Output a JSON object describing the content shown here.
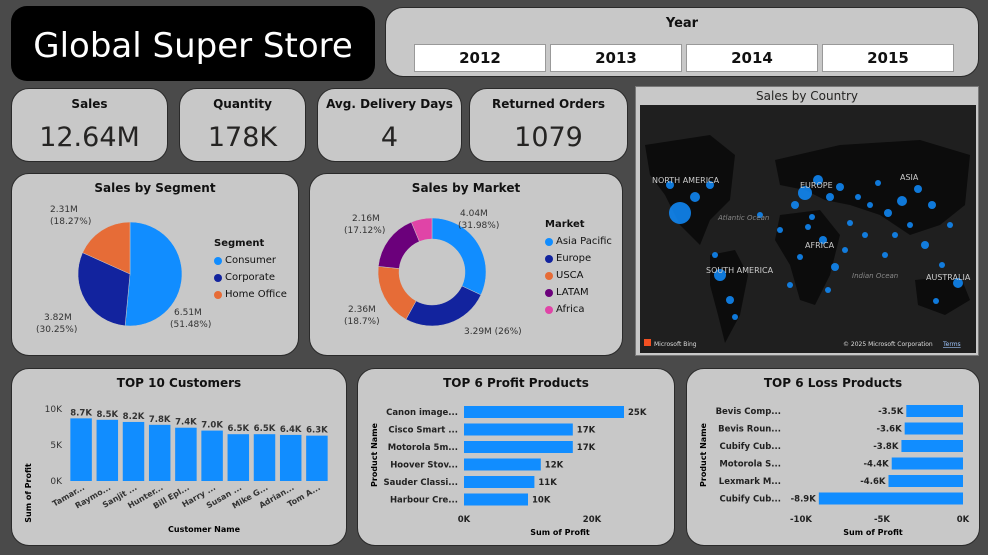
{
  "title": "Global Super Store",
  "year_filter": {
    "label": "Year",
    "options": [
      "2012",
      "2013",
      "2014",
      "2015"
    ]
  },
  "kpis": [
    {
      "label": "Sales",
      "value": "12.64M"
    },
    {
      "label": "Quantity",
      "value": "178K"
    },
    {
      "label": "Avg. Delivery Days",
      "value": "4"
    },
    {
      "label": "Returned Orders",
      "value": "1079"
    }
  ],
  "segment_chart": {
    "title": "Sales by Segment",
    "legend_title": "Segment",
    "slice_labels": [
      {
        "line1": "6.51M",
        "line2": "(51.48%)"
      },
      {
        "line1": "3.82M",
        "line2": "(30.25%)"
      },
      {
        "line1": "2.31M",
        "line2": "(18.27%)"
      }
    ]
  },
  "market_chart": {
    "title": "Sales by Market",
    "legend_title": "Market",
    "slice_labels": [
      {
        "line1": "4.04M",
        "line2": "(31.98%)"
      },
      {
        "line1": "3.29M (26%)",
        "line2": ""
      },
      {
        "line1": "2.36M",
        "line2": "(18.7%)"
      },
      {
        "line1": "2.16M",
        "line2": "(17.12%)"
      }
    ]
  },
  "map": {
    "title": "Sales by Country",
    "labels": {
      "na": "NORTH AMERICA",
      "eu": "EUROPE",
      "asia": "ASIA",
      "atl": "Atlantic Ocean",
      "af": "AFRICA",
      "sa": "SOUTH AMERICA",
      "io": "Indian Ocean",
      "au": "AUSTRALIA"
    },
    "bing": "Microsoft Bing",
    "copyright": "© 2025 Microsoft Corporation",
    "terms": "Terms"
  },
  "customers_chart": {
    "title": "TOP 10 Customers",
    "xlabel": "Customer Name",
    "ylabel": "Sum of Profit"
  },
  "profit_chart": {
    "title": "TOP 6 Profit Products",
    "xlabel": "Sum of Profit",
    "ylabel": "Product Name"
  },
  "loss_chart": {
    "title": "TOP 6 Loss Products",
    "xlabel": "Sum of Profit",
    "ylabel": "Product Name"
  },
  "colors": {
    "blue": "#118dff",
    "navy": "#12239e",
    "orange": "#e66c37",
    "purple": "#6b007b",
    "pink": "#e044a7"
  },
  "chart_data": [
    {
      "type": "pie",
      "title": "Sales by Segment",
      "legend_title": "Segment",
      "categories": [
        "Consumer",
        "Corporate",
        "Home Office"
      ],
      "values": [
        6.51,
        3.82,
        2.31
      ],
      "percents": [
        51.48,
        30.25,
        18.27
      ],
      "unit": "M",
      "legend_position": "right"
    },
    {
      "type": "pie",
      "donut": true,
      "title": "Sales by Market",
      "legend_title": "Market",
      "categories": [
        "Asia Pacific",
        "Europe",
        "USCA",
        "LATAM",
        "Africa"
      ],
      "values": [
        4.04,
        3.29,
        2.36,
        2.16,
        0.79
      ],
      "percents": [
        31.98,
        26,
        18.7,
        17.12,
        6.2
      ],
      "unit": "M",
      "legend_position": "right"
    },
    {
      "type": "bar",
      "title": "TOP 10 Customers",
      "xlabel": "Customer Name",
      "ylabel": "Sum of Profit",
      "categories": [
        "Tamar...",
        "Raymo...",
        "Sanjit ...",
        "Hunter...",
        "Bill Epl...",
        "Harry ...",
        "Susan ...",
        "Mike G...",
        "Adrian...",
        "Tom A..."
      ],
      "values": [
        8700,
        8500,
        8200,
        7800,
        7400,
        7000,
        6500,
        6500,
        6400,
        6300
      ],
      "data_labels": [
        "8.7K",
        "8.5K",
        "8.2K",
        "7.8K",
        "7.4K",
        "7.0K",
        "6.5K",
        "6.5K",
        "6.4K",
        "6.3K"
      ],
      "yticks": [
        "0K",
        "5K",
        "10K"
      ],
      "ylim": [
        0,
        10000
      ]
    },
    {
      "type": "bar",
      "orientation": "horizontal",
      "title": "TOP 6 Profit Products",
      "xlabel": "Sum of Profit",
      "ylabel": "Product Name",
      "categories": [
        "Canon image...",
        "Cisco Smart ...",
        "Motorola 5m...",
        "Hoover Stov...",
        "Sauder Classi...",
        "Harbour Cre..."
      ],
      "values": [
        25000,
        17000,
        17000,
        12000,
        11000,
        10000
      ],
      "data_labels": [
        "25K",
        "17K",
        "17K",
        "12K",
        "11K",
        "10K"
      ],
      "xticks": [
        "0K",
        "20K"
      ],
      "xlim": [
        0,
        25000
      ]
    },
    {
      "type": "bar",
      "orientation": "horizontal",
      "title": "TOP 6 Loss Products",
      "xlabel": "Sum of Profit",
      "ylabel": "Product Name",
      "categories": [
        "Bevis Comp...",
        "Bevis Roun...",
        "Cubify Cub...",
        "Motorola S...",
        "Lexmark M...",
        "Cubify Cub..."
      ],
      "values": [
        -3500,
        -3600,
        -3800,
        -4400,
        -4600,
        -8900
      ],
      "data_labels": [
        "-3.5K",
        "-3.6K",
        "-3.8K",
        "-4.4K",
        "-4.6K",
        "-8.9K"
      ],
      "xticks": [
        "-10K",
        "-5K",
        "0K"
      ],
      "xlim": [
        -10000,
        0
      ]
    }
  ]
}
